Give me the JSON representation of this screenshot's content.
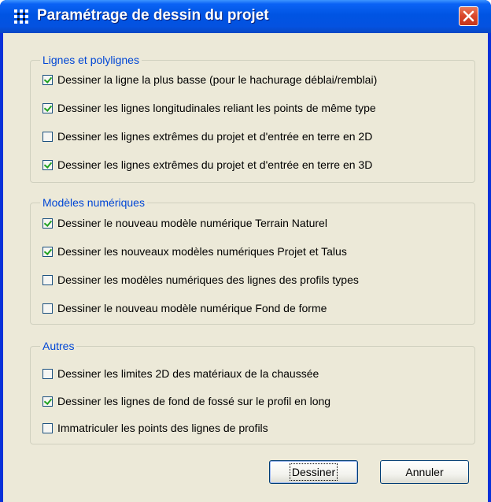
{
  "window": {
    "title": "Paramétrage de dessin du projet",
    "icon": "grid-app-icon",
    "close_icon": "close-icon"
  },
  "groups": [
    {
      "label": "Lignes et polylignes",
      "items": [
        {
          "label": "Dessiner la ligne la plus basse (pour le hachurage déblai/remblai)",
          "checked": true
        },
        {
          "label": "Dessiner les lignes longitudinales reliant les points de même type",
          "checked": true
        },
        {
          "label": "Dessiner les lignes extrêmes du projet et d'entrée en terre en 2D",
          "checked": false
        },
        {
          "label": "Dessiner les lignes extrêmes du projet et d'entrée en terre en 3D",
          "checked": true
        }
      ]
    },
    {
      "label": "Modèles numériques",
      "items": [
        {
          "label": "Dessiner le nouveau modèle numérique Terrain Naturel",
          "checked": true
        },
        {
          "label": "Dessiner les nouveaux modèles numériques Projet et Talus",
          "checked": true
        },
        {
          "label": "Dessiner les modèles numériques des lignes des profils types",
          "checked": false
        },
        {
          "label": "Dessiner le nouveau modèle numérique Fond de forme",
          "checked": false
        }
      ]
    },
    {
      "label": "Autres",
      "items": [
        {
          "label": "Dessiner les limites 2D des matériaux de la chaussée",
          "checked": false
        },
        {
          "label": "Dessiner les lignes de fond de fossé sur le profil en long",
          "checked": true
        },
        {
          "label": "Immatriculer les points des lignes de profils",
          "checked": false
        }
      ]
    }
  ],
  "buttons": {
    "draw_label": "Dessiner",
    "cancel_label": "Annuler"
  },
  "colors": {
    "titlebar": "#0054e3",
    "group_label": "#0046d5",
    "checkmark": "#21a121",
    "dialog_bg": "#ece9d8"
  }
}
